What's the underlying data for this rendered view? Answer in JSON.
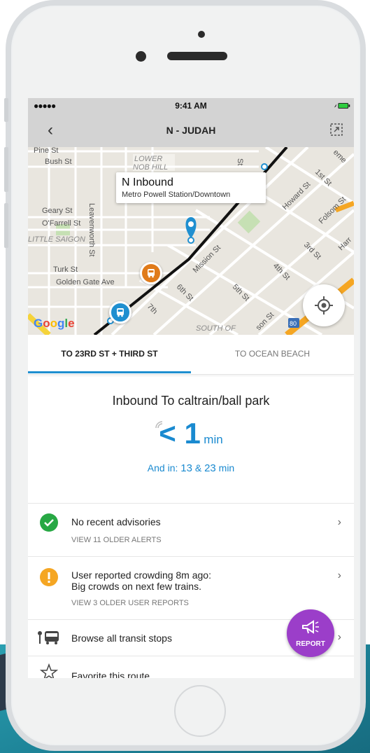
{
  "colors": {
    "accent": "#1f8fd0",
    "report": "#9b3ec9",
    "ok": "#27a844",
    "warn": "#f5a623",
    "bus_orange": "#e07b1a",
    "bus_blue": "#1f8fd0"
  },
  "status": {
    "signal": "●●●●● ",
    "time": "9:41 AM"
  },
  "nav": {
    "back": "‹",
    "title": "N - JUDAH"
  },
  "map": {
    "callout_title": "N Inbound",
    "callout_sub": "Metro Powell Station/Downtown",
    "labels": {
      "pine": "Pine St",
      "bush": "Bush St",
      "lower_nob": "LOWER",
      "nob_hill": "NOB HILL",
      "geary": "Geary St",
      "ofarrell": "O'Farrell St",
      "little_saigon": "LITTLE SAIGON",
      "leavenworth": "Leavenworth St",
      "turk": "Turk St",
      "golden_gate": "Golden Gate Ave",
      "mission": "Mission St",
      "sixth": "6th St",
      "fifth": "5th St",
      "seventh": "7th",
      "south_of": "SOUTH OF",
      "howard": "Howard St",
      "first": "1st St",
      "folsom": "Folsom St",
      "fourth": "4th St",
      "third": "3rd St",
      "harr": "Harr",
      "st": "St",
      "eme": "eme",
      "son": "son St",
      "hwy": "80"
    },
    "google": [
      "G",
      "o",
      "o",
      "g",
      "l",
      "e"
    ]
  },
  "tabs": {
    "active": "TO 23RD ST + THIRD ST",
    "inactive": "TO OCEAN BEACH"
  },
  "arrival": {
    "heading": "Inbound To caltrain/ball park",
    "eta_value": "< 1",
    "eta_unit": "min",
    "and_in_label": "And in: ",
    "next1": "13",
    "amp": " & ",
    "next2": "23",
    "next_unit": " min"
  },
  "rows": {
    "advisories": {
      "title": "No recent advisories",
      "sub": "VIEW 11 OLDER ALERTS"
    },
    "crowding": {
      "title1": "User reported crowding 8m ago:",
      "title2": "Big crowds on next few trains.",
      "sub": "VIEW 3 OLDER USER REPORTS"
    },
    "browse": {
      "title": "Browse all transit stops"
    },
    "favorite": {
      "title": "Favorite this route"
    }
  },
  "fab": {
    "label": "REPORT"
  }
}
